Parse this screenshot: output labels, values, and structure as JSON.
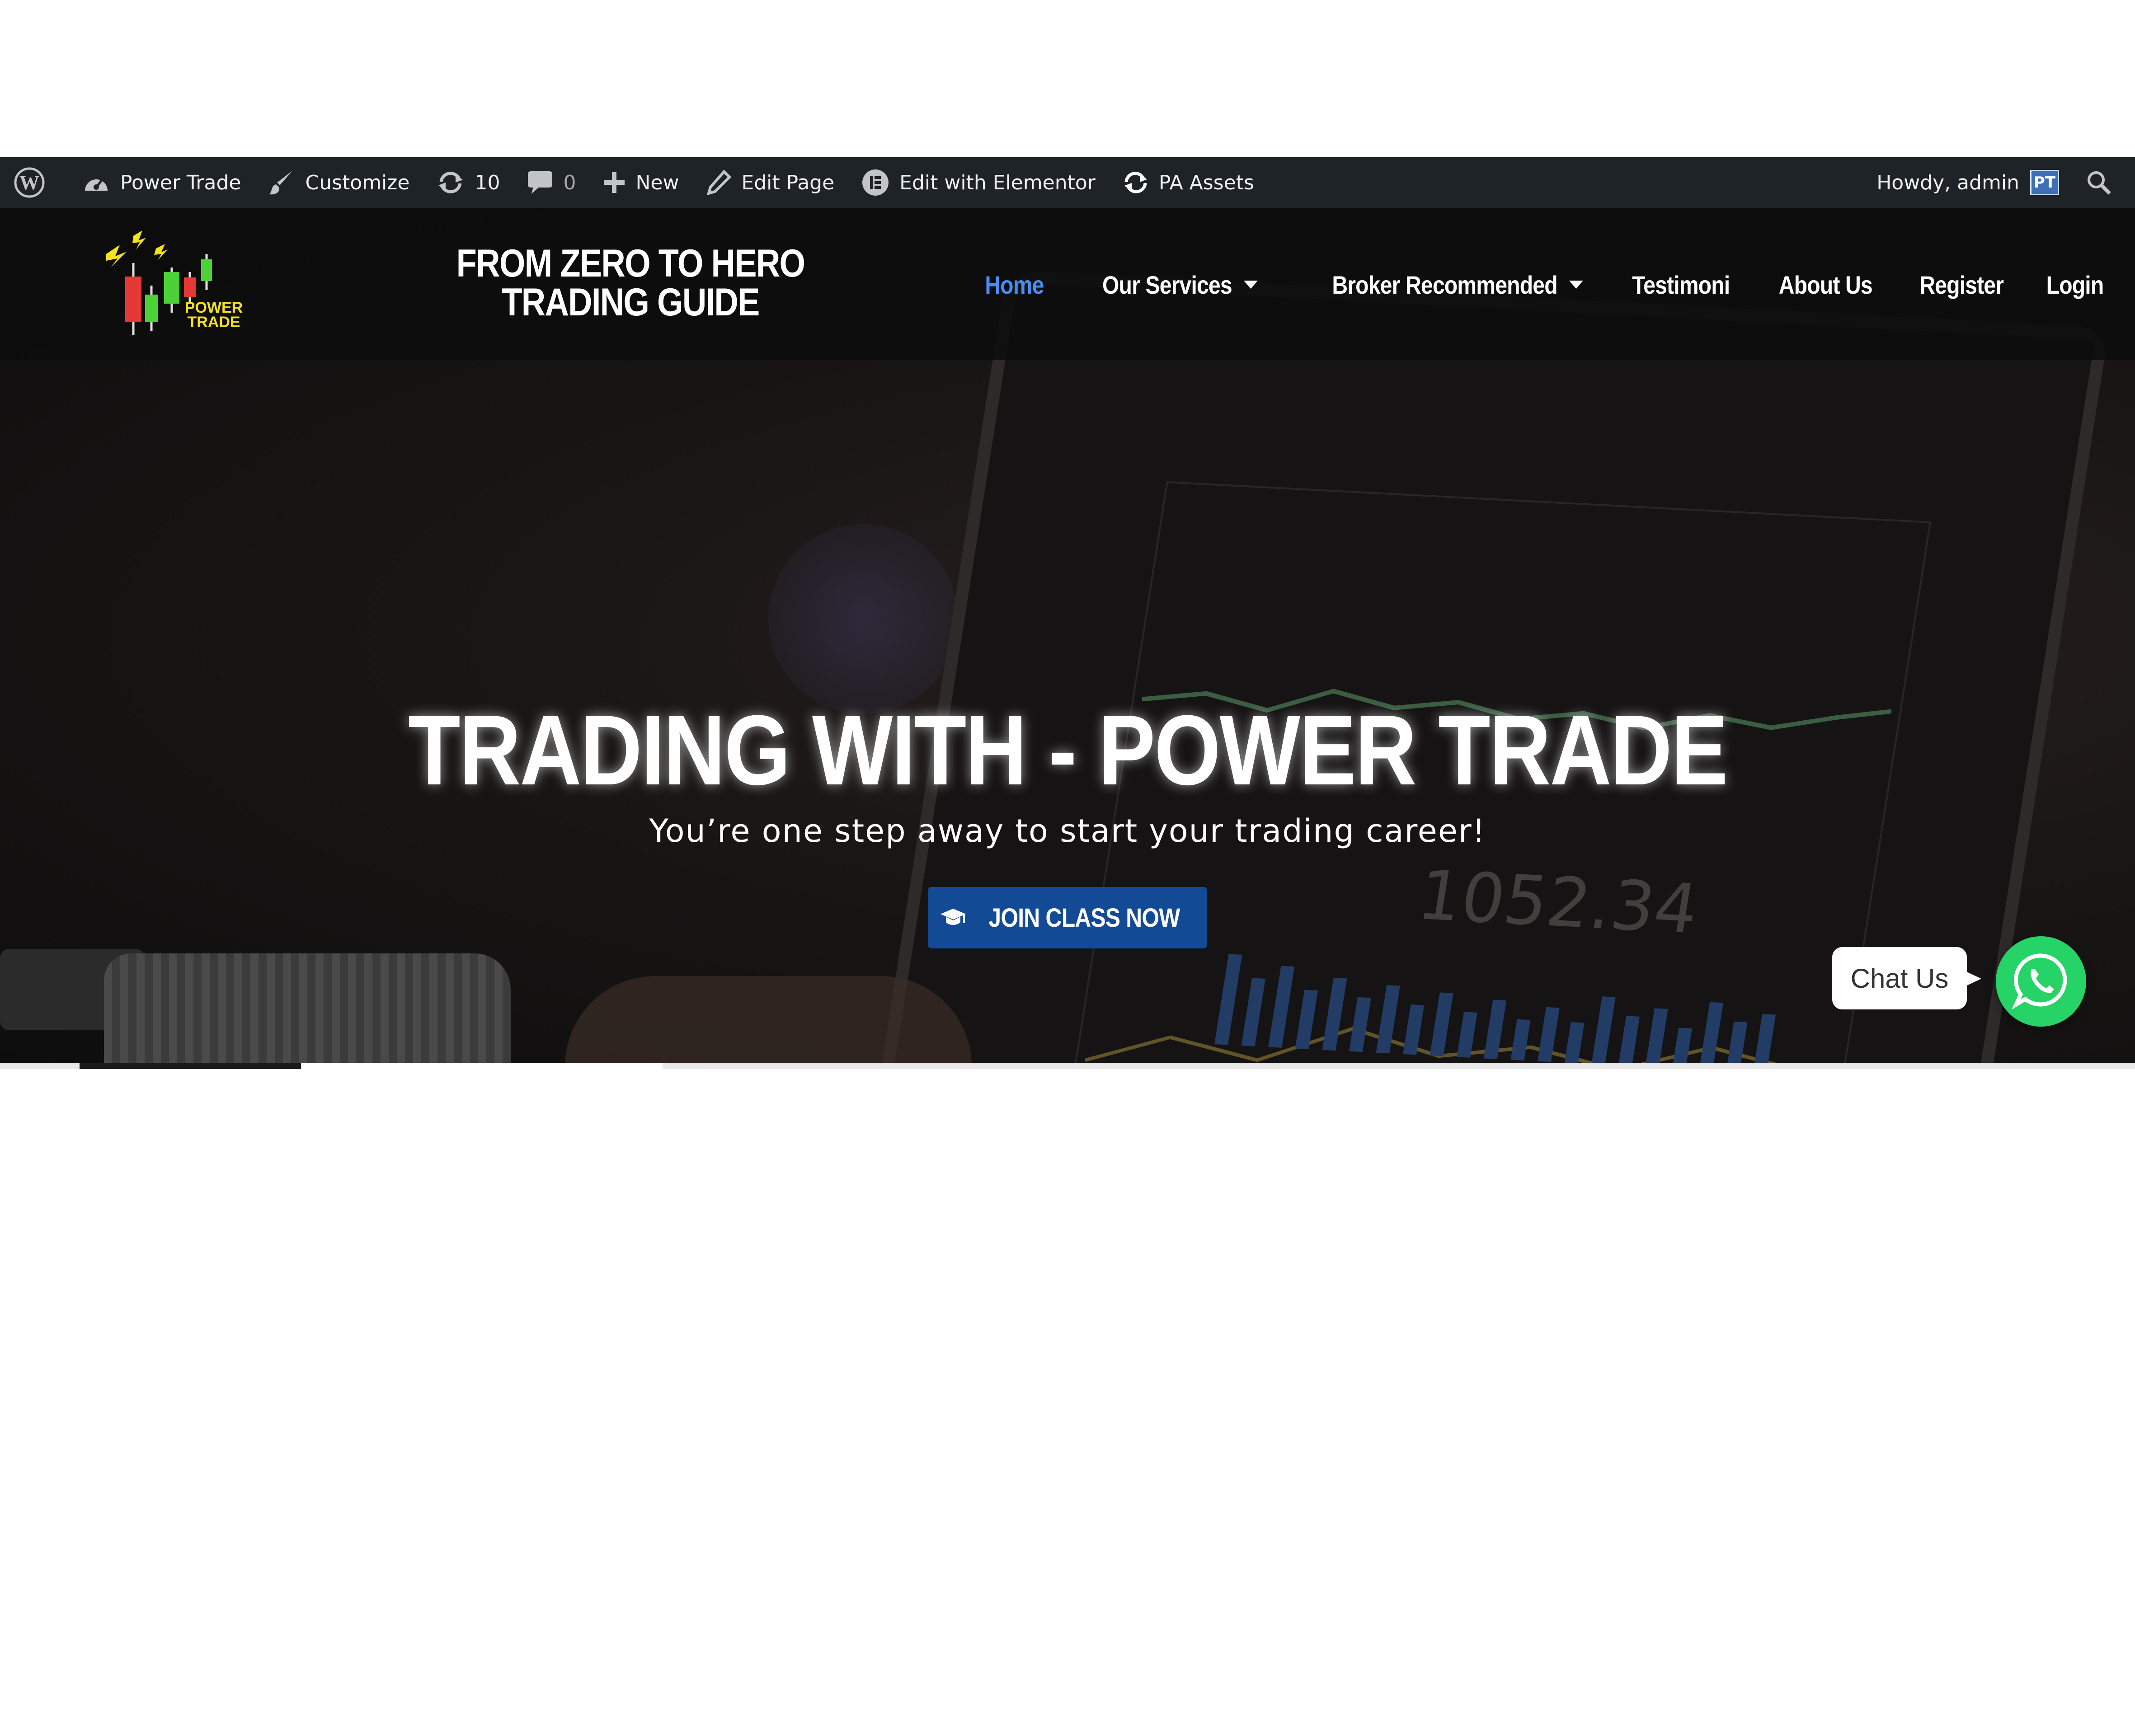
{
  "admin_bar": {
    "site_name": "Power Trade",
    "customize": "Customize",
    "updates_count": "10",
    "comments_count": "0",
    "new": "New",
    "edit_page": "Edit Page",
    "edit_elementor": "Edit with Elementor",
    "pa_assets": "PA Assets",
    "howdy": "Howdy, admin",
    "avatar_initials": "PT"
  },
  "header": {
    "logo_text_line1": "POWER",
    "logo_text_line2": "TRADE",
    "site_title": "FROM ZERO TO HERO TRADING GUIDE",
    "nav": [
      {
        "label": "Home",
        "active": true,
        "dropdown": false
      },
      {
        "label": "Our Services",
        "active": false,
        "dropdown": true
      },
      {
        "label": "Broker Recommended",
        "active": false,
        "dropdown": true
      },
      {
        "label": "Testimoni",
        "active": false,
        "dropdown": false
      },
      {
        "label": "About Us",
        "active": false,
        "dropdown": false
      },
      {
        "label": "Register",
        "active": false,
        "dropdown": false
      },
      {
        "label": "Login",
        "active": false,
        "dropdown": false
      }
    ]
  },
  "hero": {
    "title": "TRADING WITH - POWER TRADE",
    "subtitle": "You’re one step away to start your trading career!",
    "cta_label": "JOIN CLASS NOW",
    "cta_icon": "graduation-cap-icon"
  },
  "chat": {
    "label": "Chat Us",
    "icon": "whatsapp-icon"
  },
  "colors": {
    "admin_bar_bg": "#1d2327",
    "nav_active": "#4a8df0",
    "cta_bg": "#134a96",
    "whatsapp_green": "#25d366"
  }
}
